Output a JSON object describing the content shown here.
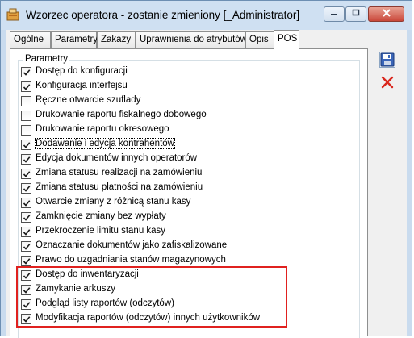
{
  "window": {
    "title": "Wzorzec operatora - zostanie zmieniony [_Administrator]"
  },
  "tabs": [
    {
      "label": "Ogólne",
      "active": false
    },
    {
      "label": "Parametry",
      "active": false
    },
    {
      "label": "Zakazy",
      "active": false
    },
    {
      "label": "Uprawnienia do atrybutów",
      "active": false
    },
    {
      "label": "Opis",
      "active": false
    },
    {
      "label": "POS",
      "active": true
    }
  ],
  "group": {
    "label": "Parametry",
    "items": [
      {
        "label": "Dostęp do konfiguracji",
        "checked": true
      },
      {
        "label": "Konfiguracja interfejsu",
        "checked": true
      },
      {
        "label": "Ręczne otwarcie szuflady",
        "checked": false
      },
      {
        "label": "Drukowanie raportu fiskalnego dobowego",
        "checked": false
      },
      {
        "label": "Drukowanie raportu okresowego",
        "checked": false
      },
      {
        "label": "Dodawanie i edycja kontrahentów",
        "checked": true
      },
      {
        "label": "Edycja dokumentów innych operatorów",
        "checked": true
      },
      {
        "label": "Zmiana statusu realizacji na zamówieniu",
        "checked": true
      },
      {
        "label": "Zmiana statusu płatności na zamówieniu",
        "checked": true
      },
      {
        "label": "Otwarcie zmiany z różnicą stanu kasy",
        "checked": true
      },
      {
        "label": "Zamknięcie zmiany bez wypłaty",
        "checked": true
      },
      {
        "label": "Przekroczenie limitu stanu kasy",
        "checked": true
      },
      {
        "label": "Oznaczanie dokumentów jako zafiskalizowane",
        "checked": true
      },
      {
        "label": "Prawo do uzgadniania stanów magazynowych",
        "checked": true
      },
      {
        "label": "Dostęp do inwentaryzacji",
        "checked": true
      },
      {
        "label": "Zamykanie arkuszy",
        "checked": true
      },
      {
        "label": "Podgląd listy raportów (odczytów)",
        "checked": true
      },
      {
        "label": "Modyfikacja raportów (odczytów) innych użytkowników",
        "checked": true
      }
    ]
  },
  "toolbar": {
    "save_icon": "save-icon",
    "cancel_icon": "cancel-x-icon"
  },
  "colors": {
    "highlight": "#e0211f",
    "cancel": "#d9261c",
    "save": "#2a4f9c"
  }
}
